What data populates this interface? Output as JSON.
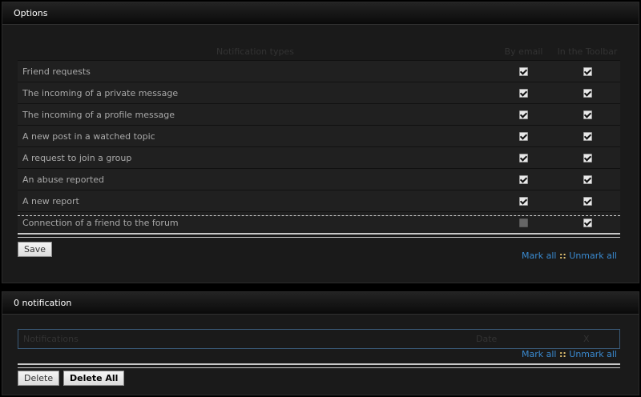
{
  "options": {
    "title": "Options",
    "columns": {
      "types": "Notification types",
      "email": "By email",
      "toolbar": "In the Toolbar"
    },
    "rows": [
      {
        "label": "Friend requests",
        "email": true,
        "toolbar": true
      },
      {
        "label": "The incoming of a private message",
        "email": true,
        "toolbar": true
      },
      {
        "label": "The incoming of a profile message",
        "email": true,
        "toolbar": true
      },
      {
        "label": "A new post in a watched topic",
        "email": true,
        "toolbar": true
      },
      {
        "label": "A request to join a group",
        "email": true,
        "toolbar": true
      },
      {
        "label": "An abuse reported",
        "email": true,
        "toolbar": true
      },
      {
        "label": "A new report",
        "email": true,
        "toolbar": true
      },
      {
        "label": "Connection of a friend to the forum",
        "email": false,
        "toolbar": true
      }
    ],
    "save_label": "Save",
    "mark_all": "Mark all",
    "separator": "::",
    "unmark_all": "Unmark all"
  },
  "notifications": {
    "title": "0 notification",
    "col_notifications": "Notifications",
    "col_date": "Date",
    "col_x": "X",
    "mark_all": "Mark all",
    "separator": "::",
    "unmark_all": "Unmark all",
    "delete_label": "Delete",
    "delete_all_label": "Delete All"
  }
}
